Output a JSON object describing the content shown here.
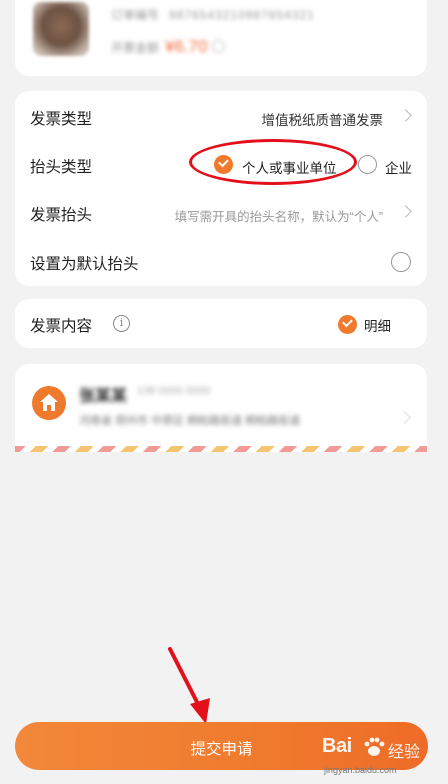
{
  "order": {
    "number_label": "订单编号",
    "number_value": "9876543210987654321",
    "amount_label": "开票金额",
    "amount_value": "¥6.70"
  },
  "invoice": {
    "type": {
      "label": "发票类型",
      "value": "增值税纸质普通发票"
    },
    "header_type": {
      "label": "抬头类型",
      "options": [
        {
          "label": "个人或事业单位",
          "selected": true
        },
        {
          "label": "企业",
          "selected": false
        }
      ]
    },
    "header": {
      "label": "发票抬头",
      "placeholder": "填写需开具的抬头名称，默认为“个人”"
    },
    "default": {
      "label": "设置为默认抬头",
      "checked": false
    }
  },
  "content": {
    "label": "发票内容",
    "info_icon": "info-icon",
    "option": {
      "label": "明细",
      "selected": true
    }
  },
  "address": {
    "icon": "home-icon",
    "name": "张某某",
    "phone": "138 0000 0000",
    "detail": "河南省 郑州市 中原区 桐柏路街道 桐柏路街道"
  },
  "submit": {
    "label": "提交申请"
  },
  "watermark": {
    "logo": "Bai",
    "suffix": "经验",
    "url": "jingyan.baidu.com"
  },
  "colors": {
    "accent": "#f07a2c",
    "annotation": "#e3101c",
    "price": "#f06a3a"
  }
}
